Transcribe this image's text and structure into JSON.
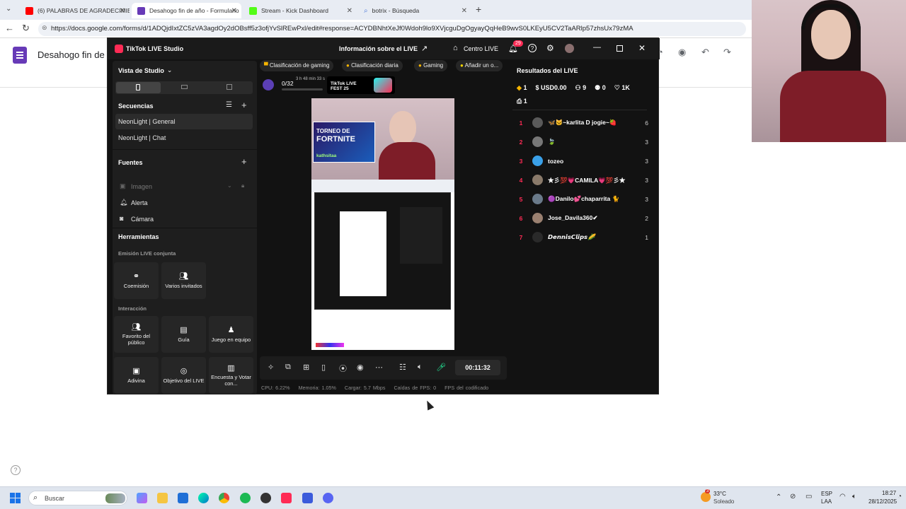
{
  "browser": {
    "tabs": [
      {
        "title": "(6) PALABRAS DE AGRADECIMIEN",
        "favicon_color": "#ff0000"
      },
      {
        "title": "Desahogo fin de año - Formulario",
        "favicon_color": "#673ab7"
      },
      {
        "title": "Stream - Kick Dashboard",
        "favicon_color": "#53fc18"
      },
      {
        "title": "botrix - Búsqueda",
        "favicon_color": "#4f7ad9"
      }
    ],
    "url": "https://docs.google.com/forms/d/1ADQjdIxtZC5zVA3agdOy2dOBsff5z3ofjYvSlREwPxl/edit#response=ACYDBNhtXeJf0Wdoh9lo9XVjcguDgOgyayQqHeB9wvS0LKEyU5CV2TaARlp57zhsUx79zMA"
  },
  "forms": {
    "title": "Desahogo fin de a"
  },
  "tiktok": {
    "app_title": "TikTok LIVE Studio",
    "live_info": "Información sobre el LIVE",
    "centro_live": "Centro LIVE",
    "notif_count": "29",
    "left": {
      "studio_view": "Vista de Studio",
      "sequences_title": "Secuencias",
      "sequences": [
        "NeonLight | General",
        "NeonLight | Chat"
      ],
      "sources_title": "Fuentes",
      "sources": [
        "Imagen",
        "Alerta",
        "Cámara"
      ],
      "tools_title": "Herramientas",
      "emision_label": "Emisión LIVE conjunta",
      "emision_tools": [
        "Coemisión",
        "Varios invitados"
      ],
      "interaccion_label": "Interacción",
      "interaccion_tools": [
        "Favorito del público",
        "Guía",
        "Juego en equipo"
      ],
      "more_tools": [
        "Adivina",
        "Objetivo del LIVE",
        "Encuesta y Votar con..."
      ]
    },
    "center": {
      "chips": [
        "Clasificación de gaming",
        "Clasificación diaria",
        "Gaming",
        "Añadir un o..."
      ],
      "progress": "0/32",
      "progress_time": "3 h 48 min 33 s",
      "fest_label": "TikTok LIVE FEST 25",
      "timer": "00:11:32",
      "stats": [
        "CPU: 6.22%",
        "Memoria: 1.05%",
        "Cargar: 5.7 Mbps",
        "Caídas de FPS: 0",
        "FPS del codificado"
      ],
      "preview": {
        "banner_title": "TORNEO DE",
        "banner_game": "FORTNITE",
        "banner_user": "kathsitaa"
      }
    },
    "right": {
      "title": "Resultados del LIVE",
      "stats": {
        "diamonds": "1",
        "usd": "USD0.00",
        "viewers": "9",
        "new_followers": "0",
        "likes": "1K",
        "gifts": "1"
      },
      "ranking": [
        {
          "rank": "1",
          "name": "🦋🐱~karlita D jogie~🍓",
          "score": "6"
        },
        {
          "rank": "2",
          "name": "🍃",
          "score": "3"
        },
        {
          "rank": "3",
          "name": "tozeo",
          "score": "3"
        },
        {
          "rank": "4",
          "name": "★彡💯💗CAMILA💗💯彡★",
          "score": "3"
        },
        {
          "rank": "5",
          "name": "🟣Danilo💕chaparrita 🐈",
          "score": "3"
        },
        {
          "rank": "6",
          "name": "Jose_Davila360✔",
          "score": "2"
        },
        {
          "rank": "7",
          "name": "𝘿𝙚𝙣𝙣𝙞𝙨𝘾𝙡𝙞𝙥𝙨🌽",
          "score": "1"
        }
      ]
    }
  },
  "taskbar": {
    "search": "Buscar",
    "weather_temp": "33°C",
    "weather_desc": "Soleado",
    "weather_badge": "3",
    "lang": "ESP",
    "lang2": "LAA",
    "time": "18:27",
    "date": "28/12/2025"
  },
  "colors": {
    "tiktok_bg": "#121212",
    "accent_red": "#ff2b55",
    "forms_purple": "#673ab7"
  }
}
